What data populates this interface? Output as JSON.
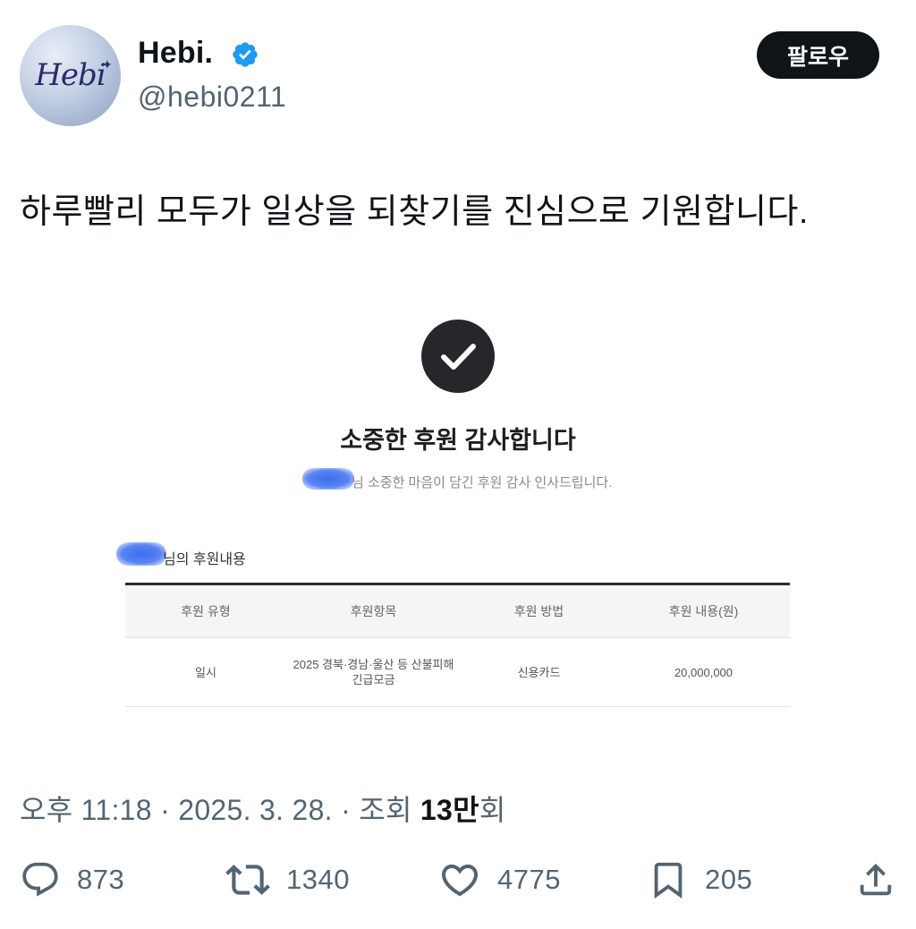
{
  "profile": {
    "display_name": "Hebi.",
    "handle": "@hebi0211",
    "avatar_logo_text": "Hebi",
    "follow_label": "팔로우"
  },
  "tweet": {
    "text": "하루빨리 모두가 일상을 되찾기를 진심으로 기원합니다."
  },
  "media": {
    "title": "소중한 후원 감사합니다",
    "subtitle": "님 소중한 마음이 담긴 후원 감사 인사드립니다.",
    "detail_heading": "님의 후원내용",
    "table": {
      "headers": [
        "후원 유형",
        "후원항목",
        "후원 방법",
        "후원 내용(원)"
      ],
      "row": {
        "type": "일시",
        "item_line1": "2025 경북·경남·울산 등 산불피해",
        "item_line2": "긴급모금",
        "method": "신용카드",
        "amount": "20,000,000"
      }
    }
  },
  "meta": {
    "time": "오후 11:18",
    "date": "2025. 3. 28.",
    "views_prefix": "조회",
    "views_count": "13만",
    "views_suffix": "회"
  },
  "actions": {
    "reply_count": "873",
    "retweet_count": "1340",
    "like_count": "4775",
    "bookmark_count": "205"
  },
  "colors": {
    "verified": "#1d9bf0",
    "text_primary": "#0f1419",
    "text_secondary": "#536471"
  }
}
